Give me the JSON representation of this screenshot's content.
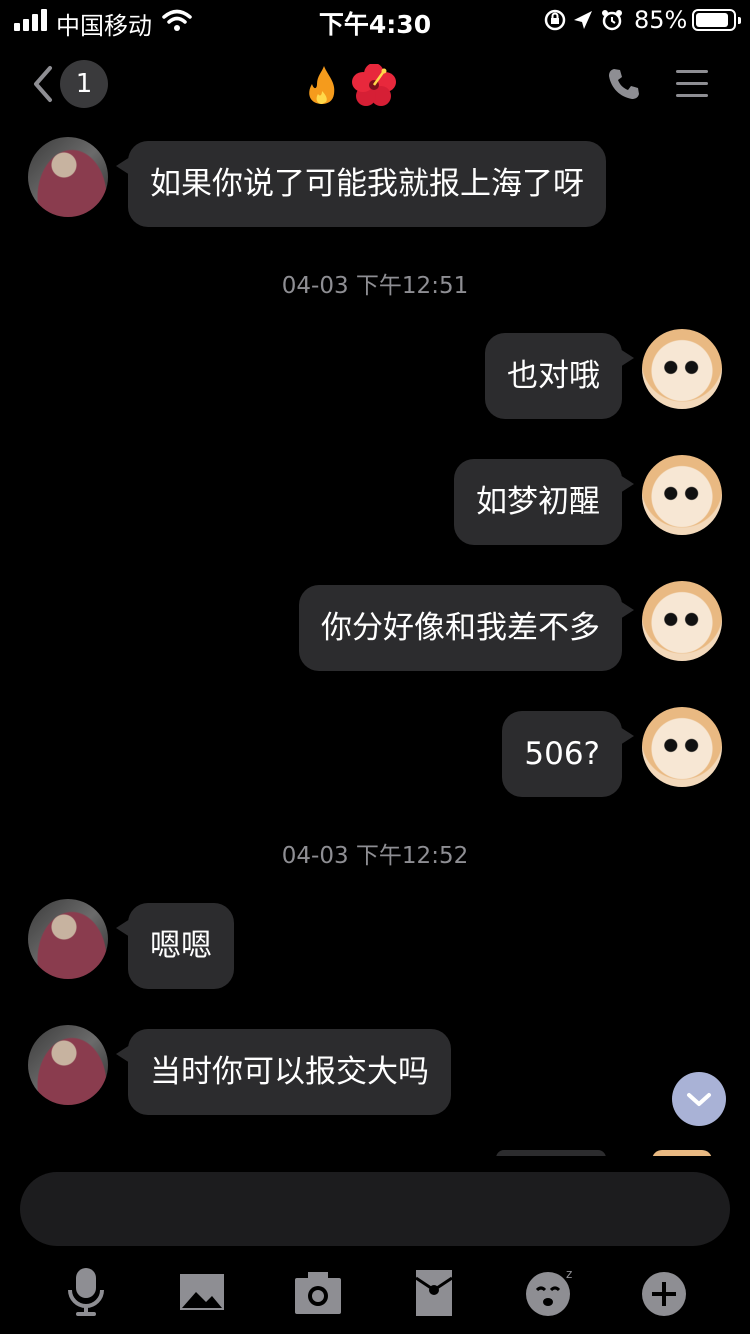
{
  "status_bar": {
    "carrier": "中国移动",
    "time": "下午4:30",
    "battery": "85%"
  },
  "nav": {
    "unread_count": "1",
    "title_emojis": [
      "fire",
      "hibiscus"
    ]
  },
  "messages": [
    {
      "side": "left",
      "text": "如果你说了可能我就报上海了呀"
    },
    {
      "type": "timestamp",
      "text": "04-03 下午12:51"
    },
    {
      "side": "right",
      "text": "也对哦"
    },
    {
      "side": "right",
      "text": "如梦初醒"
    },
    {
      "side": "right",
      "text": "你分好像和我差不多"
    },
    {
      "side": "right",
      "text": "506?"
    },
    {
      "type": "timestamp",
      "text": "04-03 下午12:52"
    },
    {
      "side": "left",
      "text": "嗯嗯"
    },
    {
      "side": "left",
      "text": "当时你可以报交大吗"
    }
  ],
  "colors": {
    "background": "#000000",
    "bubble": "#2c2c2e",
    "timestamp": "#8e8e93",
    "scroll_button": "#a9b2d6"
  },
  "toolbar_icons": [
    "microphone-icon",
    "image-icon",
    "camera-icon",
    "red-packet-icon",
    "emoji-icon",
    "plus-icon"
  ]
}
